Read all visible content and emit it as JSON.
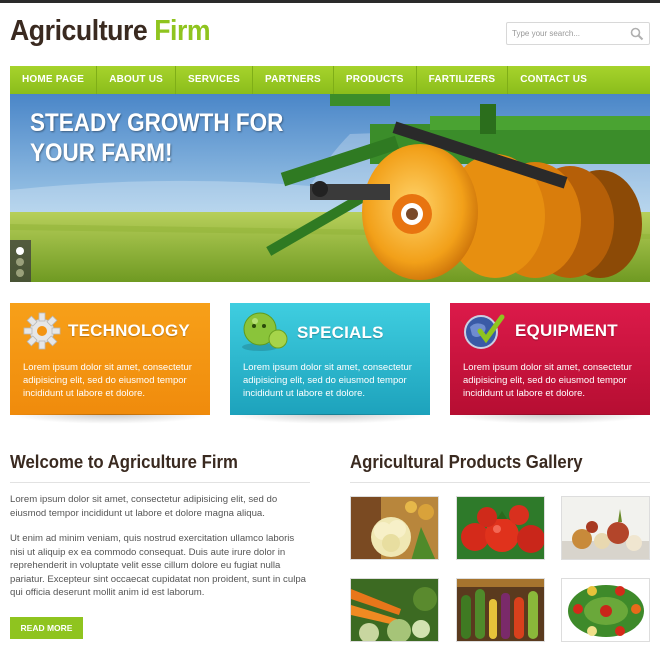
{
  "header": {
    "logo_main": "Agriculture",
    "logo_accent": "Firm",
    "search_placeholder": "Type your search..."
  },
  "nav": {
    "items": [
      "HOME PAGE",
      "ABOUT US",
      "SERVICES",
      "PARTNERS",
      "PRODUCTS",
      "FARTILIZERS",
      "CONTACT US"
    ]
  },
  "hero": {
    "headline_line1": "STEADY GROWTH FOR",
    "headline_line2": "YOUR FARM!"
  },
  "features": [
    {
      "title": "TECHNOLOGY",
      "text": "Lorem ipsum dolor sit amet, consectetur adipisicing elit, sed do eiusmod tempor incididunt ut labore et dolore.",
      "icon": "gear-icon",
      "color": "#f39412"
    },
    {
      "title": "SPECIALS",
      "text": "Lorem ipsum dolor sit amet, consectetur adipisicing elit, sed do eiusmod tempor incididunt ut labore et dolore.",
      "icon": "smiley-icon",
      "color": "#2bb8cf"
    },
    {
      "title": "EQUIPMENT",
      "text": "Lorem ipsum dolor sit amet, consectetur adipisicing elit, sed do eiusmod tempor incididunt ut labore et dolore.",
      "icon": "globe-check-icon",
      "color": "#c9133d"
    }
  ],
  "welcome": {
    "title": "Welcome to Agriculture Firm",
    "para1": "Lorem ipsum dolor sit amet, consectetur adipisicing elit, sed do eiusmod tempor incididunt ut labore et dolore magna aliqua.",
    "para2": "Ut enim ad minim veniam, quis nostrud exercitation ullamco laboris nisi ut aliquip ex ea commodo consequat. Duis aute irure dolor in reprehenderit in voluptate velit esse cillum dolore eu fugiat nulla pariatur. Excepteur sint occaecat cupidatat non proident, sunt in culpa qui officia deserunt mollit anim id est laborum.",
    "button": "READ MORE"
  },
  "gallery": {
    "title": "Agricultural Products Gallery",
    "items": [
      "cauliflower-photo",
      "tomatoes-photo",
      "onions-photo",
      "carrots-photo",
      "mixed-vegetables-photo",
      "vegetable-wreath-photo"
    ]
  },
  "colors": {
    "accent": "#8fc41f",
    "heading": "#3a2a20"
  }
}
